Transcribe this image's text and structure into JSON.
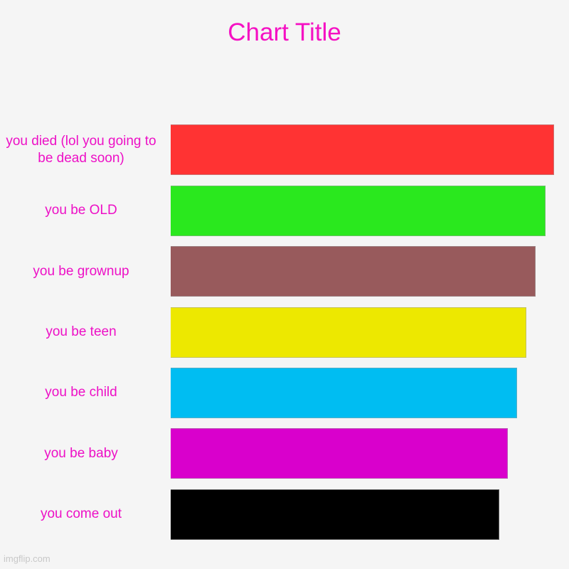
{
  "chart_data": {
    "type": "bar",
    "orientation": "horizontal",
    "title": "Chart Title",
    "xlabel": "",
    "ylabel": "",
    "grid": false,
    "legend": false,
    "title_color": "#f511c3",
    "label_color": "#ed10c6",
    "background_color": "#f5f5f5",
    "xlim": [
      0,
      100
    ],
    "categories": [
      "you died (lol you going to be dead soon)",
      "you be OLD",
      "you be grownup",
      "you be teen",
      "you be child",
      "you be baby",
      "you come out"
    ],
    "values": [
      100,
      97.7,
      95.1,
      92.8,
      90.4,
      88.0,
      85.7
    ],
    "colors": [
      "#ff3333",
      "#2ae81e",
      "#985a5c",
      "#ede800",
      "#00bdf2",
      "#d900cc",
      "#000000"
    ],
    "bars": [
      {
        "label": "you died (lol you going to be dead soon)",
        "value": 100,
        "color": "#ff3333"
      },
      {
        "label": "you be OLD",
        "value": 97.7,
        "color": "#2ae81e"
      },
      {
        "label": "you be grownup",
        "value": 95.1,
        "color": "#985a5c"
      },
      {
        "label": "you be teen",
        "value": 92.8,
        "color": "#ede800"
      },
      {
        "label": "you be child",
        "value": 90.4,
        "color": "#00bdf2"
      },
      {
        "label": "you be baby",
        "value": 88.0,
        "color": "#d900cc"
      },
      {
        "label": "you come out",
        "value": 85.7,
        "color": "#000000"
      }
    ]
  },
  "watermark": {
    "text": "imgflip.com"
  }
}
